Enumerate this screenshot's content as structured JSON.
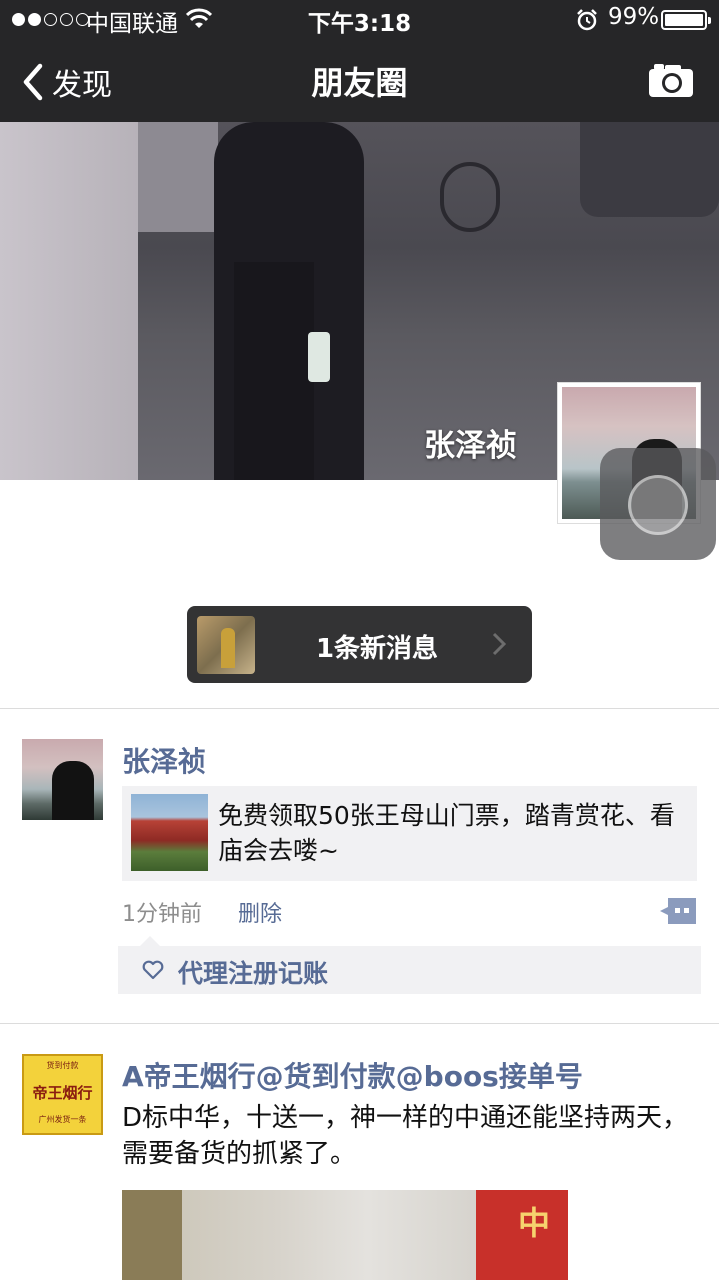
{
  "status": {
    "carrier": "中国联通",
    "time": "下午3:18",
    "battery": "99%"
  },
  "nav": {
    "back_label": "发现",
    "title": "朋友圈"
  },
  "cover": {
    "user_name": "张泽祯"
  },
  "new_message": {
    "label": "1条新消息"
  },
  "posts": [
    {
      "author": "张泽祯",
      "share_text": "免费领取50张王母山门票，踏青赏花、看庙会去喽~",
      "time": "1分钟前",
      "delete_label": "删除",
      "likes": "代理注册记账"
    },
    {
      "author": "A帝王烟行@货到付款@boos接单号",
      "avatar_text": {
        "top": "货到付款",
        "main": "帝王烟行",
        "bottom": "广州发货一条"
      },
      "text": "D标中华，十送一，神一样的中通还能坚持两天，需要备货的抓紧了。",
      "photo_text": "中"
    }
  ],
  "colors": {
    "nav_bg": "#262628",
    "link": "#576b95",
    "panel": "#f1f1f3"
  },
  "icons": [
    "signal-dots-icon",
    "wifi-icon",
    "alarm-icon",
    "battery-icon",
    "back-chevron-icon",
    "camera-icon",
    "chevron-right-icon",
    "comment-icon",
    "heart-icon"
  ]
}
